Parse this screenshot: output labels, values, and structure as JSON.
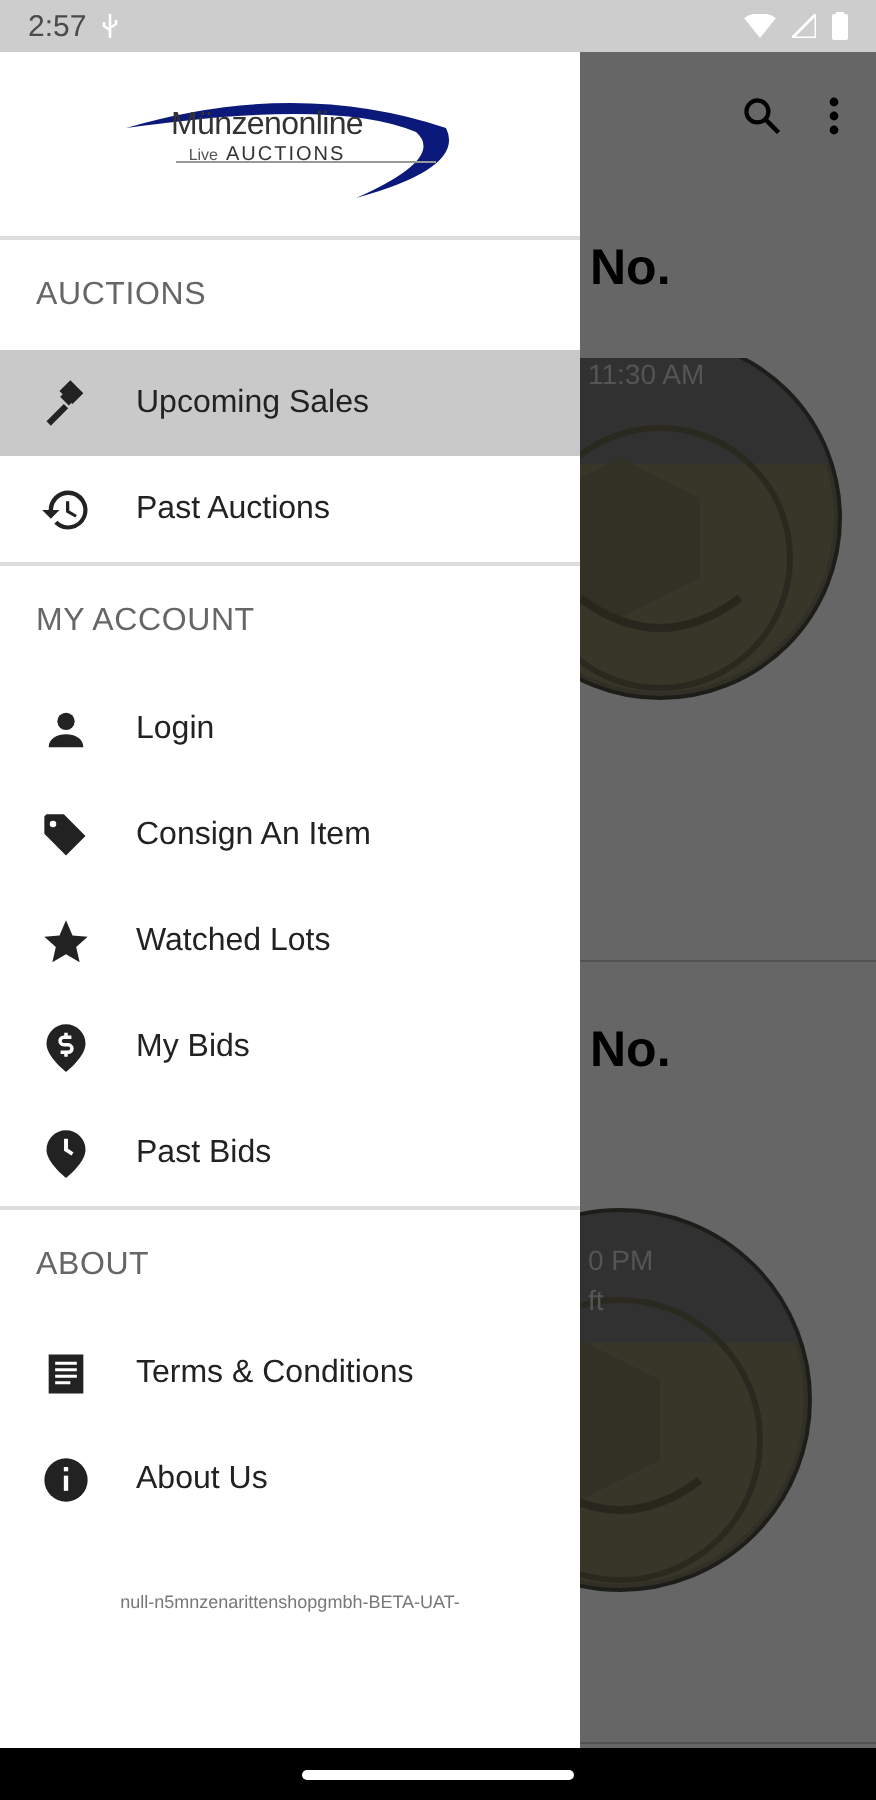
{
  "status_bar": {
    "time": "2:57"
  },
  "background": {
    "cards": [
      {
        "title": "No.",
        "line_1": "11:30 AM"
      },
      {
        "title": "No.",
        "line_1": "0 PM",
        "line_2": "ft"
      }
    ]
  },
  "drawer": {
    "logo": {
      "name": "Münzenonline",
      "tagline_1": "Live",
      "tagline_2": "AUCTIONS"
    },
    "sections": [
      {
        "title": "AUCTIONS",
        "items": [
          {
            "kind": "gavel",
            "label": "Upcoming Sales",
            "selected": true
          },
          {
            "kind": "history",
            "label": "Past Auctions",
            "selected": false
          }
        ]
      },
      {
        "title": "MY ACCOUNT",
        "items": [
          {
            "kind": "person",
            "label": "Login",
            "selected": false
          },
          {
            "kind": "tag",
            "label": "Consign An Item",
            "selected": false
          },
          {
            "kind": "star",
            "label": "Watched Lots",
            "selected": false
          },
          {
            "kind": "dollar",
            "label": "My Bids",
            "selected": false
          },
          {
            "kind": "clock",
            "label": "Past Bids",
            "selected": false
          }
        ]
      },
      {
        "title": "ABOUT",
        "items": [
          {
            "kind": "document",
            "label": "Terms & Conditions",
            "selected": false
          },
          {
            "kind": "info",
            "label": "About Us",
            "selected": false
          }
        ]
      }
    ],
    "footer": "null-n5mnzenarittenshopgmbh-BETA-UAT-"
  }
}
